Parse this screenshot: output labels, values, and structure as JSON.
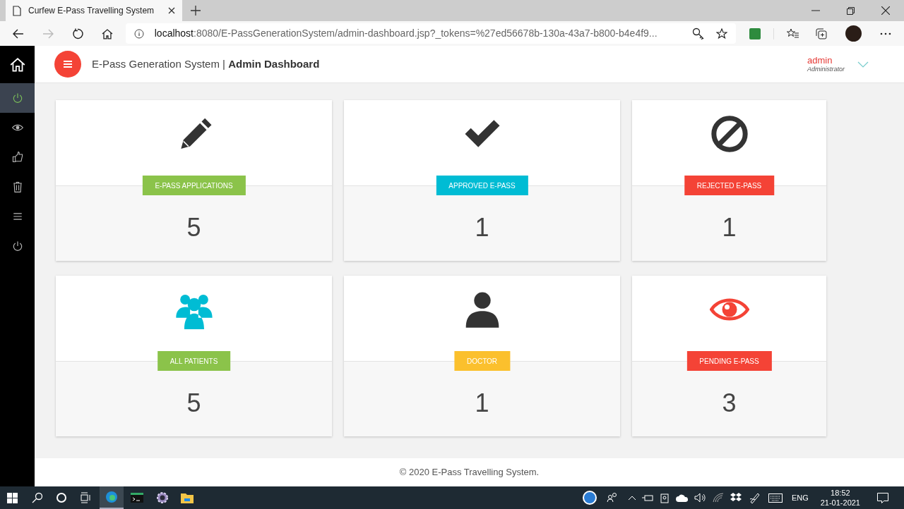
{
  "browser": {
    "tab_title": "Curfew E-Pass Travelling System",
    "url_host": "localhost",
    "url_rest": ":8080/E-PassGenerationSystem/admin-dashboard.jsp?_tokens=%27ed56678b-130a-43a7-b800-b4e4f9..."
  },
  "sidebar": {
    "items": [
      {
        "selected": false
      },
      {
        "selected": true
      },
      {
        "selected": false
      },
      {
        "selected": false
      },
      {
        "selected": false
      },
      {
        "selected": false
      },
      {
        "selected": false
      }
    ]
  },
  "header": {
    "title": "E-Pass Generation System | ",
    "title_bold": "Admin Dashboard",
    "user_name": "admin",
    "user_role": "Administrator"
  },
  "cards": [
    {
      "label": "E-PASS APPLICATIONS",
      "color": "#8bc34a",
      "count": "5"
    },
    {
      "label": "APPROVED E-PASS",
      "color": "#00bcd4",
      "count": "1"
    },
    {
      "label": "REJECTED E-PASS",
      "color": "#f44336",
      "count": "1"
    },
    {
      "label": "ALL PATIENTS",
      "color": "#8bc34a",
      "count": "5"
    },
    {
      "label": "DOCTOR",
      "color": "#fbc02d",
      "count": "1"
    },
    {
      "label": "PENDING E-PASS",
      "color": "#f44336",
      "count": "3"
    }
  ],
  "footer": "© 2020 E-Pass Travelling System.",
  "taskbar": {
    "language": "ENG",
    "time": "18:52",
    "date": "21-01-2021"
  }
}
